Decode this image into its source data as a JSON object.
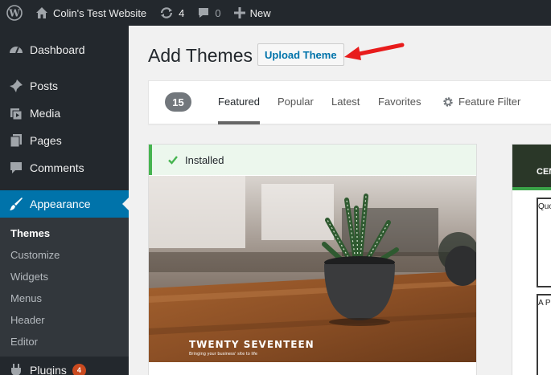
{
  "adminbar": {
    "site_name": "Colin's Test Website",
    "updates_count": "4",
    "comments_count": "0",
    "new_label": "New"
  },
  "sidebar": {
    "items": [
      {
        "label": "Dashboard",
        "icon": "dashboard-icon"
      },
      {
        "label": "Posts",
        "icon": "pushpin-icon"
      },
      {
        "label": "Media",
        "icon": "media-icon"
      },
      {
        "label": "Pages",
        "icon": "pages-icon"
      },
      {
        "label": "Comments",
        "icon": "comment-icon"
      },
      {
        "label": "Appearance",
        "icon": "brush-icon"
      }
    ],
    "submenu": [
      "Themes",
      "Customize",
      "Widgets",
      "Menus",
      "Header",
      "Editor"
    ],
    "plugins": {
      "label": "Plugins",
      "badge": "4"
    }
  },
  "main": {
    "title": "Add Themes",
    "upload_button": "Upload Theme",
    "filter": {
      "count": "15",
      "tabs": [
        "Featured",
        "Popular",
        "Latest",
        "Favorites"
      ],
      "feature_filter": "Feature Filter"
    },
    "theme_card": {
      "installed_label": "Installed",
      "screenshot_title": "TWENTY SEVENTEEN",
      "screenshot_tagline": "Bringing your business' site to life"
    },
    "partial_card": {
      "title_fragment": "CEN",
      "block1_fragment": "Quo",
      "block2_fragment": "A P"
    }
  },
  "colors": {
    "adminbar_bg": "#23282d",
    "accent": "#0073aa",
    "installed_green": "#46b450",
    "badge": "#ca4a1f",
    "arrow_red": "#e81c1c"
  }
}
